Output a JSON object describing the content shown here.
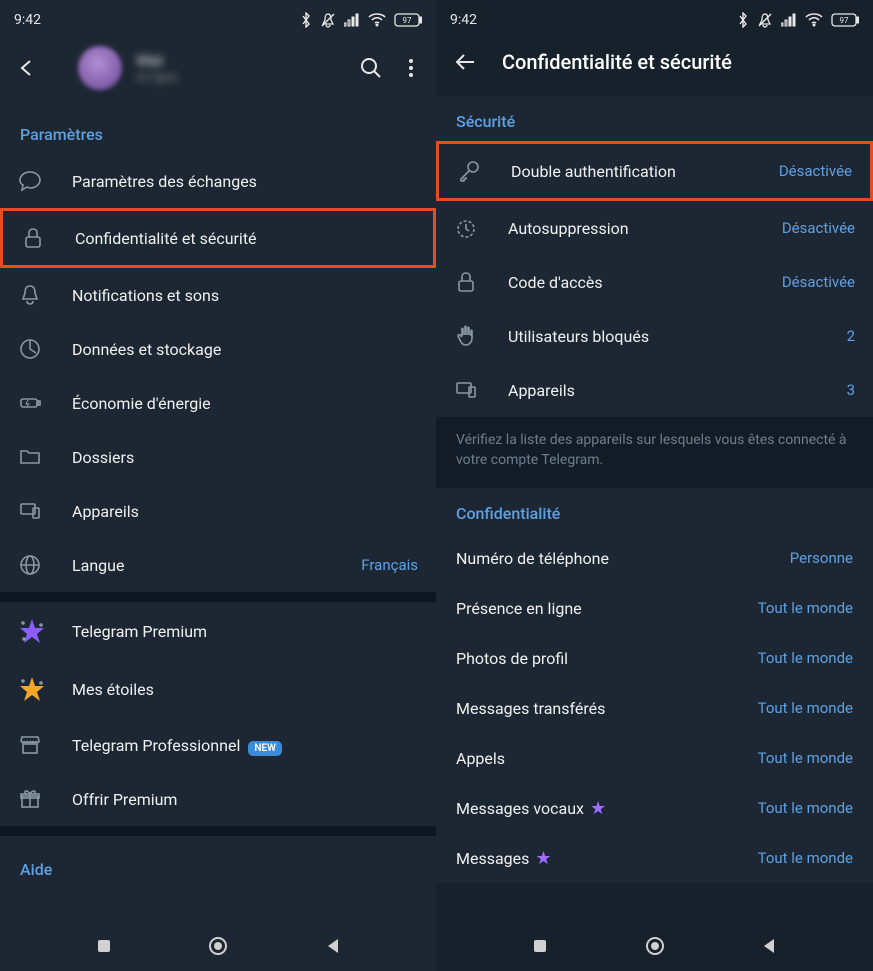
{
  "status": {
    "time": "9:42",
    "battery": "97"
  },
  "left": {
    "section_title": "Paramètres",
    "items": [
      {
        "label": "Paramètres des échanges"
      },
      {
        "label": "Confidentialité et sécurité"
      },
      {
        "label": "Notifications et sons"
      },
      {
        "label": "Données et stockage"
      },
      {
        "label": "Économie d'énergie"
      },
      {
        "label": "Dossiers"
      },
      {
        "label": "Appareils"
      },
      {
        "label": "Langue",
        "value": "Français"
      }
    ],
    "premium": [
      {
        "label": "Telegram Premium"
      },
      {
        "label": "Mes étoiles"
      },
      {
        "label": "Telegram Professionnel",
        "badge": "NEW"
      },
      {
        "label": "Offrir Premium"
      }
    ],
    "help": "Aide"
  },
  "right": {
    "page_title": "Confidentialité et sécurité",
    "security_title": "Sécurité",
    "security": [
      {
        "label": "Double authentification",
        "value": "Désactivée"
      },
      {
        "label": "Autosuppression",
        "value": "Désactivée"
      },
      {
        "label": "Code d'accès",
        "value": "Désactivée"
      },
      {
        "label": "Utilisateurs bloqués",
        "value": "2"
      },
      {
        "label": "Appareils",
        "value": "3"
      }
    ],
    "security_hint": "Vérifiez la liste des appareils sur lesquels vous êtes connecté à votre compte Telegram.",
    "privacy_title": "Confidentialité",
    "privacy": [
      {
        "label": "Numéro de téléphone",
        "value": "Personne"
      },
      {
        "label": "Présence en ligne",
        "value": "Tout le monde"
      },
      {
        "label": "Photos de profil",
        "value": "Tout le monde"
      },
      {
        "label": "Messages transférés",
        "value": "Tout le monde"
      },
      {
        "label": "Appels",
        "value": "Tout le monde"
      },
      {
        "label": "Messages vocaux",
        "value": "Tout le monde",
        "star": true
      },
      {
        "label": "Messages",
        "value": "Tout le monde",
        "star": true
      }
    ]
  }
}
